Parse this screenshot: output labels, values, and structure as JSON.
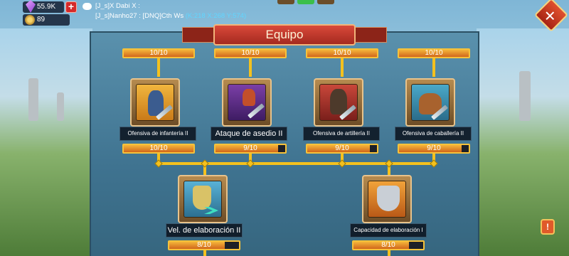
{
  "header": {
    "gems": "55.9K",
    "plus_label": "+",
    "power": "89"
  },
  "chat": {
    "line1": "[J_s]X Dabi X :",
    "line2_name": "[J_s]Nanho27 :",
    "line2_text": "[DNQ]Cth  Ws",
    "line2_coords": "(K:218 X:268 Y:574)"
  },
  "panel": {
    "title": "Equipo",
    "close_label": "✕"
  },
  "top_bars": [
    "10/10",
    "10/10",
    "10/10",
    "10/10"
  ],
  "skills_row1": [
    {
      "label": "Ofensiva de infantería II",
      "progress": "10/10",
      "fill": 1.0,
      "big": false
    },
    {
      "label": "Ataque de asedio II",
      "progress": "9/10",
      "fill": 0.9,
      "big": true
    },
    {
      "label": "Ofensiva de artillería II",
      "progress": "9/10",
      "fill": 0.9,
      "big": false
    },
    {
      "label": "Ofensiva de caballería II",
      "progress": "9/10",
      "fill": 0.9,
      "big": false
    }
  ],
  "skills_row2": [
    {
      "label": "Vel. de elaboración II",
      "progress": "8/10",
      "fill": 0.8,
      "big": true
    },
    {
      "label": "Capacidad de elaboración I",
      "progress": "8/10",
      "fill": 0.8,
      "big": false
    }
  ],
  "colors": {
    "gold_line": "#f4c11e",
    "bar_fill": "#d1661b",
    "ribbon": "#c0392b"
  },
  "quest_label": "!"
}
